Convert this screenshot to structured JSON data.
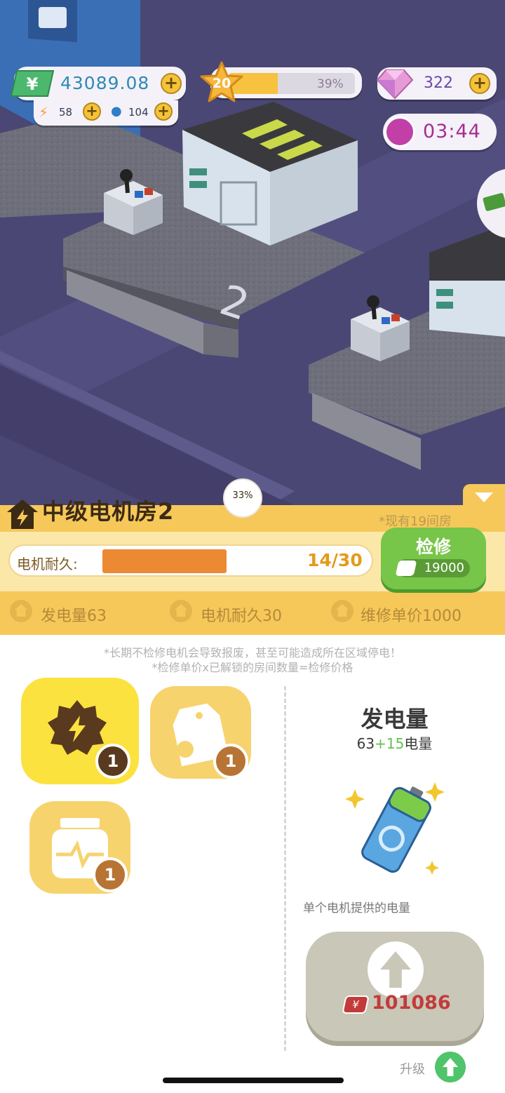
{
  "hud": {
    "money": "43089.08",
    "energy": "58",
    "water": "104",
    "level": "20",
    "level_progress_label": "39%",
    "level_progress": 0.39,
    "gems": "322",
    "timer": "03:44"
  },
  "room": {
    "title": "中级电机房2",
    "completion": "33%",
    "room_count": "*现有19间房",
    "durability_label": "电机耐久:",
    "durability_value": "14/30",
    "durability_progress": 0.4667,
    "repair_label": "检修",
    "repair_cost": "19000",
    "stats": [
      "发电量63",
      "电机耐久30",
      "维修单价1000"
    ]
  },
  "notes": {
    "line1": "*长期不检修电机会导致报废，甚至可能造成所在区域停电！",
    "line2": "*检修单价x已解锁的房间数量=检修价格"
  },
  "skills": [
    {
      "name": "gear-bolt",
      "level": "1"
    },
    {
      "name": "tag-wrench",
      "level": "1"
    },
    {
      "name": "monitor-jar",
      "level": "1"
    }
  ],
  "detail": {
    "title": "发电量",
    "base": "63",
    "bonus": "+15",
    "unit": "电量",
    "description": "单个电机提供的电量",
    "upgrade_cost": "101086",
    "upgrade_label": "升级"
  },
  "colors": {
    "panel_yellow": "#f6c859",
    "repair_green": "#77c549",
    "durability_orange": "#ec8a34",
    "cost_red": "#c23b3b",
    "scene_bg": "#4a4774"
  }
}
